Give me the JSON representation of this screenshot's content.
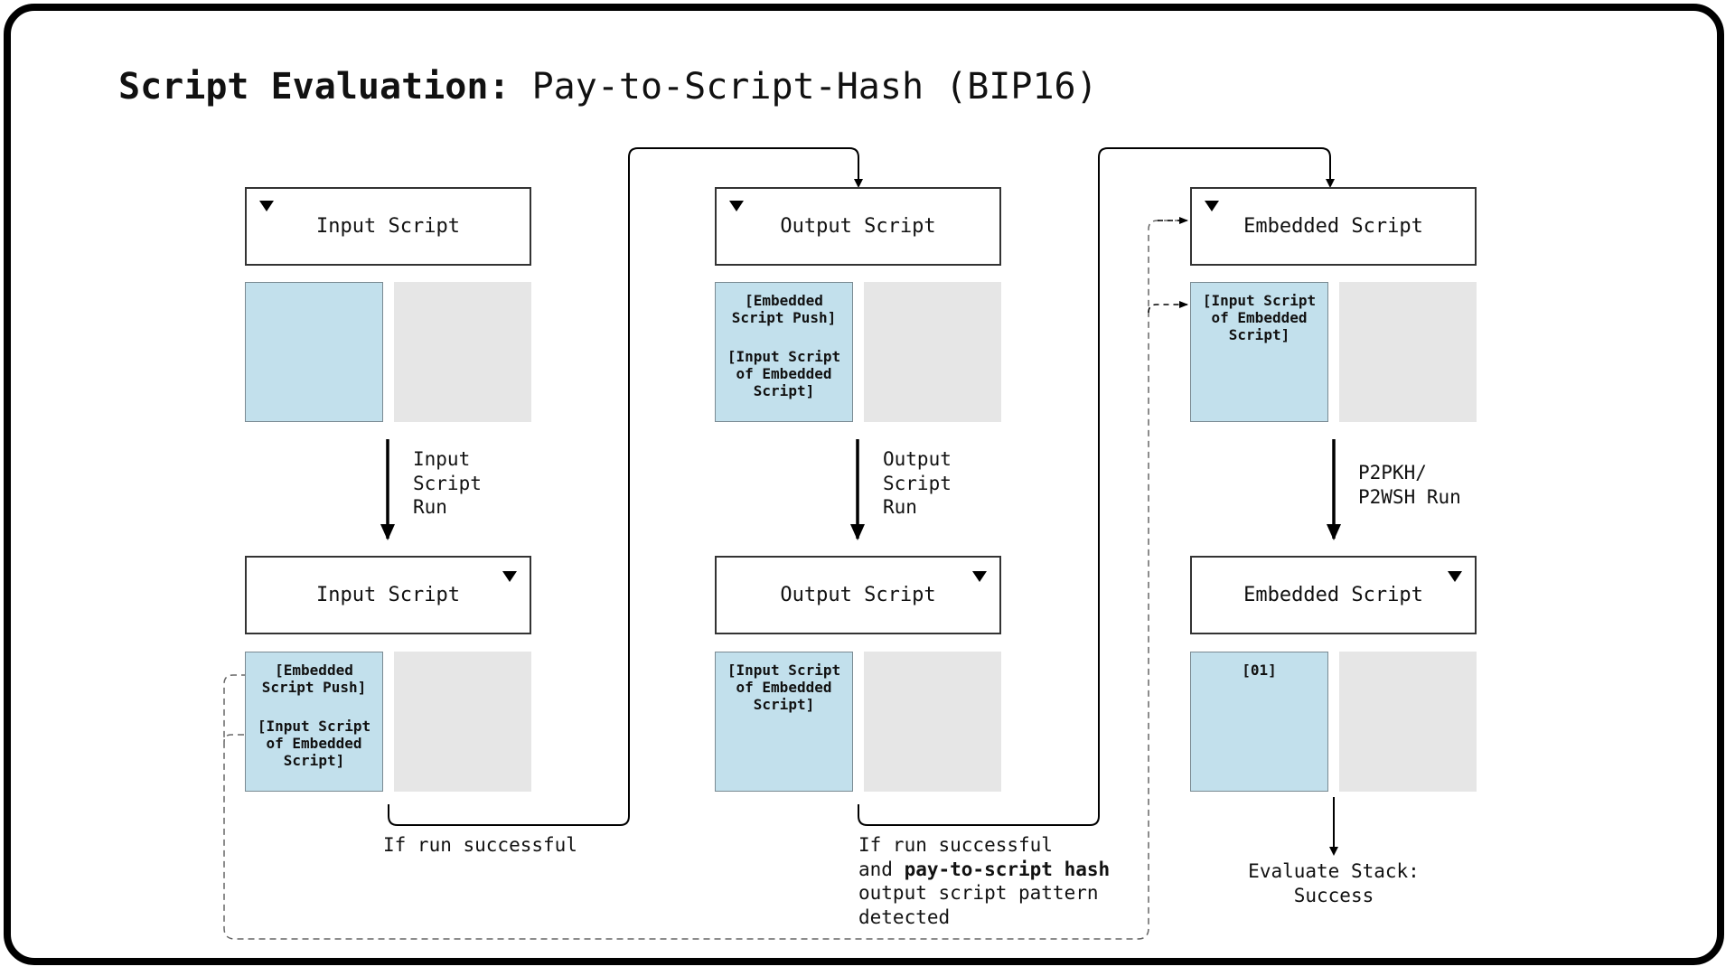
{
  "title": {
    "bold": "Script Evaluation:",
    "rest": " Pay-to-Script-Hash (BIP16)"
  },
  "columns": [
    {
      "top": {
        "header": "Input Script",
        "stack_items": []
      },
      "run_label": "Input\nScript\nRun",
      "bottom": {
        "header": "Input Script",
        "stack_items": [
          "[Embedded\nScript Push]",
          "[Input Script\nof Embedded\nScript]"
        ]
      },
      "transition_label": "If run successful"
    },
    {
      "top": {
        "header": "Output Script",
        "stack_items": [
          "[Embedded\nScript Push]",
          "[Input Script\nof Embedded\nScript]"
        ]
      },
      "run_label": "Output\nScript\nRun",
      "bottom": {
        "header": "Output Script",
        "stack_items": [
          "[Input Script\nof Embedded\nScript]"
        ]
      },
      "transition_label": {
        "line1": "If run successful",
        "line2_prefix": "and ",
        "line2_bold": "pay-to-script hash",
        "line3": "output script pattern",
        "line4": "detected"
      }
    },
    {
      "top": {
        "header": "Embedded Script",
        "stack_items": [
          "[Input Script\nof Embedded\nScript]"
        ]
      },
      "run_label": "P2PKH/\nP2WSH Run",
      "bottom": {
        "header": "Embedded Script",
        "stack_items": [
          "[01]"
        ]
      },
      "result_label": "Evaluate Stack:\nSuccess"
    }
  ],
  "colors": {
    "stack_main": "#c2e0ec",
    "stack_alt": "#e6e6e6",
    "line": "#000000",
    "dashed": "#666666"
  }
}
